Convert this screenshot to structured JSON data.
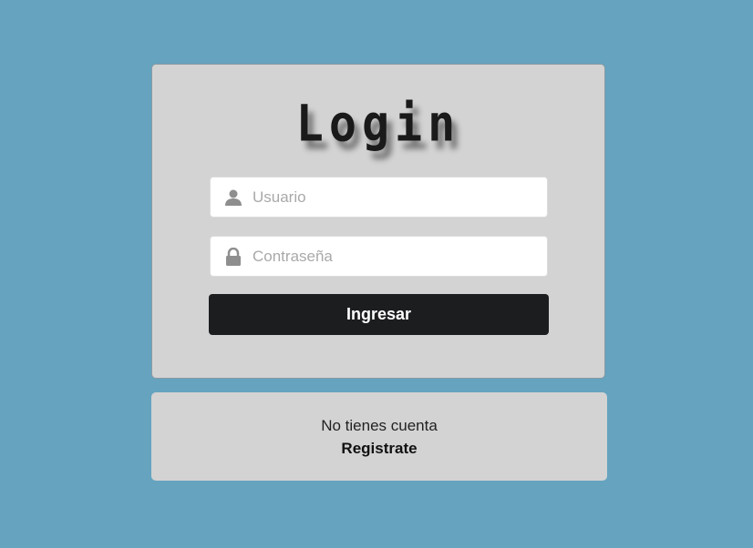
{
  "login": {
    "title": "Login",
    "username": {
      "placeholder": "Usuario",
      "value": "",
      "icon": "user-icon"
    },
    "password": {
      "placeholder": "Contraseña",
      "value": "",
      "icon": "lock-icon"
    },
    "submit_label": "Ingresar"
  },
  "register": {
    "question": "No tienes cuenta",
    "link_label": "Registrate"
  },
  "colors": {
    "background": "#65a3bf",
    "card": "#d3d3d3",
    "button": "#1c1d1f",
    "icon": "#8e8e8e"
  }
}
